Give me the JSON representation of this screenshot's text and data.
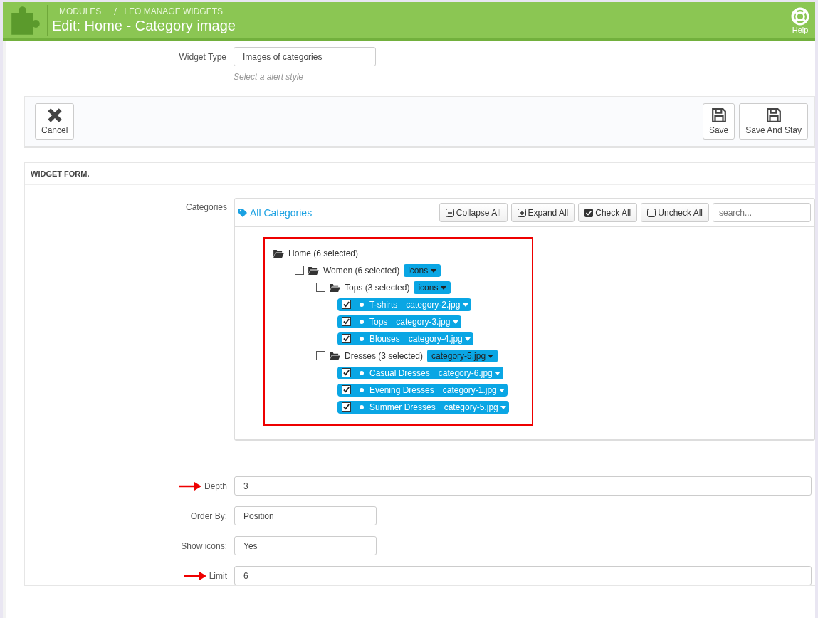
{
  "header": {
    "breadcrumb": [
      "MODULES",
      "LEO MANAGE WIDGETS"
    ],
    "title": "Edit: Home - Category image",
    "help": "Help"
  },
  "widget_type": {
    "label": "Widget Type",
    "value": "Images of categories",
    "hint": "Select a alert style"
  },
  "toolbar": {
    "left": [
      {
        "label": "Cancel",
        "kind": "cancel"
      }
    ],
    "right": [
      {
        "label": "Save",
        "kind": "save"
      },
      {
        "label": "Save And Stay",
        "kind": "save"
      }
    ]
  },
  "form": {
    "title": "WIDGET FORM.",
    "categories_label": "Categories",
    "tree_panel": {
      "title": "All Categories",
      "buttons": [
        {
          "label": "Collapse All",
          "kind": "minus"
        },
        {
          "label": "Expand All",
          "kind": "plus"
        },
        {
          "label": "Check All",
          "kind": "checked"
        },
        {
          "label": "Uncheck All",
          "kind": "unchecked"
        }
      ],
      "search_placeholder": "search...",
      "highlighted": true,
      "tree": [
        {
          "label": "Home (6 selected)",
          "kind": "root",
          "children": [
            {
              "label": "Women (6 selected)",
              "kind": "folder",
              "checked": false,
              "image": "icons",
              "children": [
                {
                  "label": "Tops (3 selected)",
                  "kind": "folder",
                  "checked": false,
                  "image": "icons",
                  "children": [
                    {
                      "label": "T-shirts",
                      "kind": "leaf",
                      "checked": true,
                      "image": "category-2.jpg"
                    },
                    {
                      "label": "Tops",
                      "kind": "leaf",
                      "checked": true,
                      "image": "category-3.jpg"
                    },
                    {
                      "label": "Blouses",
                      "kind": "leaf",
                      "checked": true,
                      "image": "category-4.jpg"
                    }
                  ]
                },
                {
                  "label": "Dresses (3 selected)",
                  "kind": "folder",
                  "checked": false,
                  "image": "category-5.jpg",
                  "children": [
                    {
                      "label": "Casual Dresses",
                      "kind": "leaf",
                      "checked": true,
                      "image": "category-6.jpg"
                    },
                    {
                      "label": "Evening Dresses",
                      "kind": "leaf",
                      "checked": true,
                      "image": "category-1.jpg"
                    },
                    {
                      "label": "Summer Dresses",
                      "kind": "leaf",
                      "checked": true,
                      "image": "category-5.jpg"
                    }
                  ]
                }
              ]
            }
          ]
        }
      ]
    },
    "fields": [
      {
        "label": "Depth",
        "value": "3",
        "wide": true,
        "arrow": true
      },
      {
        "label": "Order By:",
        "value": "Position",
        "wide": false,
        "arrow": false
      },
      {
        "label": "Show icons:",
        "value": "Yes",
        "wide": false,
        "arrow": false
      },
      {
        "label": "Limit",
        "value": "6",
        "wide": true,
        "arrow": true
      }
    ]
  }
}
